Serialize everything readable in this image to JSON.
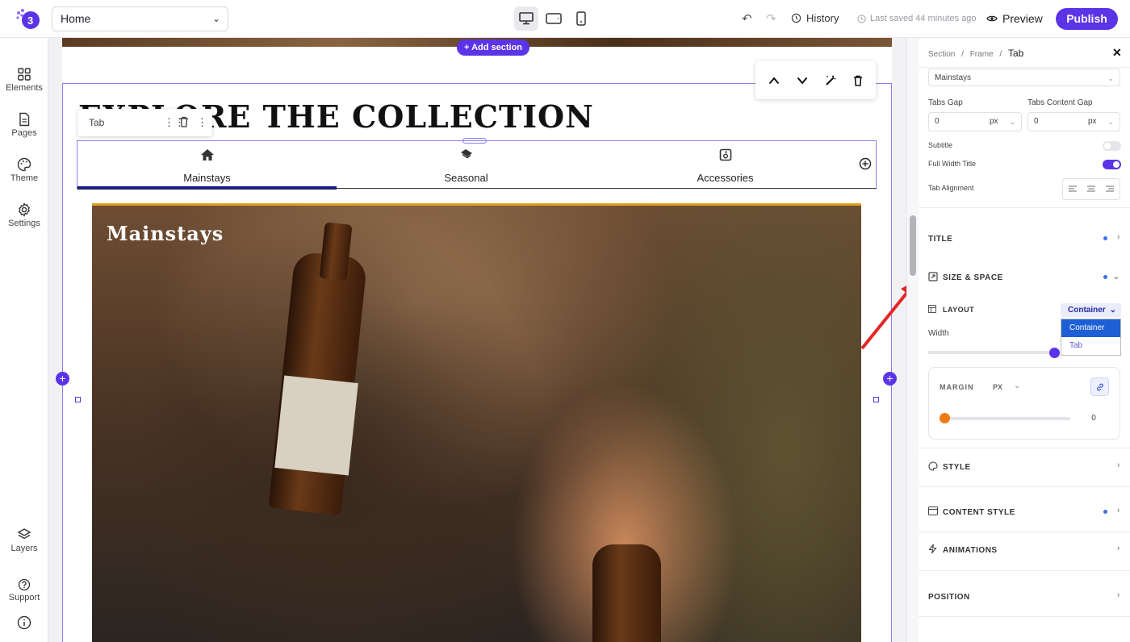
{
  "topbar": {
    "page_select": "Home",
    "history_label": "History",
    "saved_text": "Last saved 44 minutes ago",
    "preview_label": "Preview",
    "publish_label": "Publish"
  },
  "leftbar": {
    "items": [
      {
        "label": "Elements",
        "icon": "grid-icon"
      },
      {
        "label": "Pages",
        "icon": "page-icon"
      },
      {
        "label": "Theme",
        "icon": "palette-icon"
      },
      {
        "label": "Settings",
        "icon": "gear-icon"
      },
      {
        "label": "Layers",
        "icon": "layers-icon"
      },
      {
        "label": "Support",
        "icon": "help-icon"
      }
    ]
  },
  "canvas": {
    "add_section_label": "+ Add section",
    "heading": "EXPLORE THE COLLECTION",
    "tab_chip_label": "Tab",
    "tabs": [
      {
        "label": "Mainstays",
        "icon": "home-icon",
        "active": true
      },
      {
        "label": "Seasonal",
        "icon": "leaf-icon",
        "active": false
      },
      {
        "label": "Accessories",
        "icon": "box-icon",
        "active": false
      }
    ],
    "photo_title": "Mainstays"
  },
  "panel": {
    "breadcrumb": [
      "Section",
      "Frame",
      "Tab"
    ],
    "tab_select": "Mainstays",
    "tabs_gap_label": "Tabs Gap",
    "tabs_gap_value": "0",
    "tabs_gap_unit": "px",
    "tabs_content_gap_label": "Tabs Content Gap",
    "tabs_content_gap_value": "0",
    "tabs_content_gap_unit": "px",
    "subtitle_label": "Subtitle",
    "subtitle_on": false,
    "full_width_title_label": "Full Width Title",
    "full_width_title_on": true,
    "tab_alignment_label": "Tab Alignment",
    "sections": {
      "title": "TITLE",
      "size_space": "SIZE & SPACE",
      "style": "STYLE",
      "content_style": "CONTENT STYLE",
      "animations": "ANIMATIONS",
      "position": "POSITION"
    },
    "layout_label": "LAYOUT",
    "layout_value": "Container",
    "layout_options": [
      "Container",
      "Tab"
    ],
    "width_label": "Width",
    "width_slider": 1.0,
    "margin_label": "MARGIN",
    "margin_unit": "PX",
    "margin_value": "0",
    "margin_slider": 0.0,
    "accent_color": "#5b34e8",
    "annotation_arrow_color": "#e32626"
  }
}
